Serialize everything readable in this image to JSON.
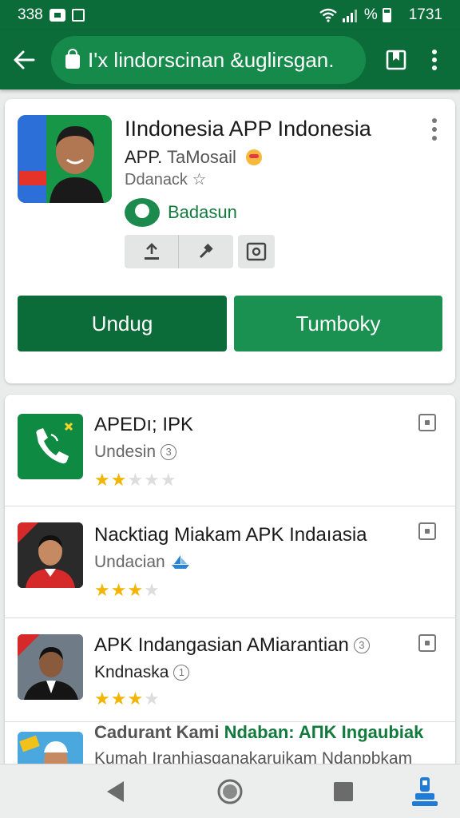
{
  "status_bar": {
    "left_text": "338",
    "right_time": "1731",
    "percent_symbol": "%"
  },
  "toolbar": {
    "url_text": "I'x lindorscinan &uglirsgan."
  },
  "app": {
    "title": "IIndonesia APP Indonesia",
    "subtitle_a": "APP.",
    "subtitle_b": "TaMosail",
    "developer": "Ddanack",
    "badge_label": "Badasun",
    "download_label": "Undug",
    "secondary_label": "Tumboky"
  },
  "list": [
    {
      "title": "APEDı; IPK",
      "sub": "Undesin",
      "sub_badge": "3",
      "stars_on": "★★",
      "stars_off": "★★★",
      "rating": 2
    },
    {
      "title": "Nacktiag Miakam APK Indaıasia",
      "sub": "Undacian",
      "stars_on": "★★★",
      "stars_off": "★",
      "rating": 3
    },
    {
      "title": "APK Indangasian AMiarantian",
      "title_badge": "3",
      "sub": "Kndnaska",
      "sub_badge": "1",
      "stars_on": "★★★",
      "stars_off": "★",
      "rating": 3
    },
    {
      "title_a": "Cadurant Kami",
      "title_b": "Ndaban: AΠK Ingaubiak",
      "sub": "Kumah Iranhiasganakaruikam Ndanpbkam"
    }
  ],
  "colors": {
    "primary": "#0b6b39",
    "accent": "#1a9150",
    "star": "#f2b400"
  },
  "icons": [
    "back-arrow-icon",
    "lock-icon",
    "bookmark-icon",
    "more-vert-icon",
    "download-icon",
    "hammer-icon",
    "camera-icon",
    "phone-icon",
    "nav-back-icon",
    "nav-home-icon",
    "nav-recents-icon",
    "nav-accessibility-icon"
  ]
}
